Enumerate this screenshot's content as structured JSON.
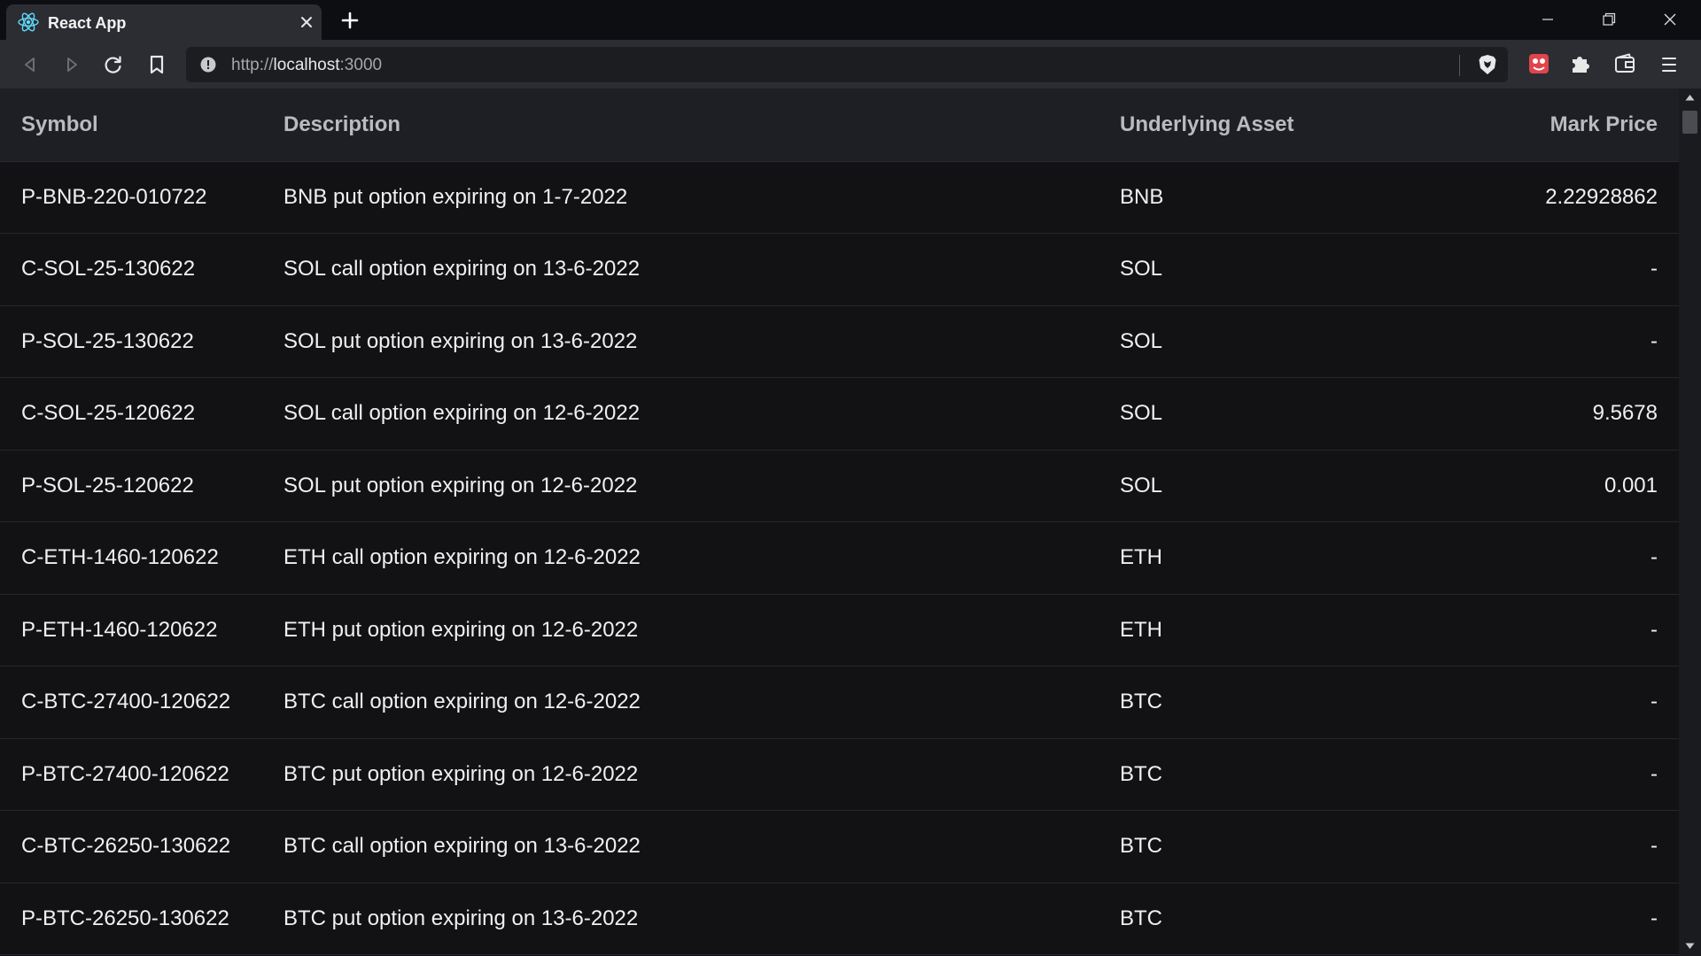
{
  "browser": {
    "tab": {
      "title": "React App",
      "favicon": "react-icon"
    },
    "url": {
      "scheme": "http://",
      "host": "localhost",
      "port": ":3000"
    },
    "icons": [
      "back-icon",
      "forward-icon",
      "reload-icon",
      "bookmark-icon",
      "info-icon",
      "brave-shield-icon",
      "extension-icon",
      "puzzle-icon",
      "wallet-icon",
      "menu-icon"
    ]
  },
  "table": {
    "headers": {
      "symbol": "Symbol",
      "description": "Description",
      "underlying": "Underlying Asset",
      "mark_price": "Mark Price"
    },
    "rows": [
      {
        "symbol": "P-BNB-220-010722",
        "description": "BNB put option expiring on 1-7-2022",
        "underlying": "BNB",
        "mark_price": "2.22928862"
      },
      {
        "symbol": "C-SOL-25-130622",
        "description": "SOL call option expiring on 13-6-2022",
        "underlying": "SOL",
        "mark_price": "-"
      },
      {
        "symbol": "P-SOL-25-130622",
        "description": "SOL put option expiring on 13-6-2022",
        "underlying": "SOL",
        "mark_price": "-"
      },
      {
        "symbol": "C-SOL-25-120622",
        "description": "SOL call option expiring on 12-6-2022",
        "underlying": "SOL",
        "mark_price": "9.5678"
      },
      {
        "symbol": "P-SOL-25-120622",
        "description": "SOL put option expiring on 12-6-2022",
        "underlying": "SOL",
        "mark_price": "0.001"
      },
      {
        "symbol": "C-ETH-1460-120622",
        "description": "ETH call option expiring on 12-6-2022",
        "underlying": "ETH",
        "mark_price": "-"
      },
      {
        "symbol": "P-ETH-1460-120622",
        "description": "ETH put option expiring on 12-6-2022",
        "underlying": "ETH",
        "mark_price": "-"
      },
      {
        "symbol": "C-BTC-27400-120622",
        "description": "BTC call option expiring on 12-6-2022",
        "underlying": "BTC",
        "mark_price": "-"
      },
      {
        "symbol": "P-BTC-27400-120622",
        "description": "BTC put option expiring on 12-6-2022",
        "underlying": "BTC",
        "mark_price": "-"
      },
      {
        "symbol": "C-BTC-26250-130622",
        "description": "BTC call option expiring on 13-6-2022",
        "underlying": "BTC",
        "mark_price": "-"
      },
      {
        "symbol": "P-BTC-26250-130622",
        "description": "BTC put option expiring on 13-6-2022",
        "underlying": "BTC",
        "mark_price": "-"
      }
    ]
  },
  "colors": {
    "tabbar_bg": "#0d0e12",
    "toolbar_bg": "#2b2d33",
    "page_bg": "#121215",
    "header_bg": "#1e1f24",
    "react_blue": "#61dafb",
    "extension_red": "#e0444c"
  }
}
